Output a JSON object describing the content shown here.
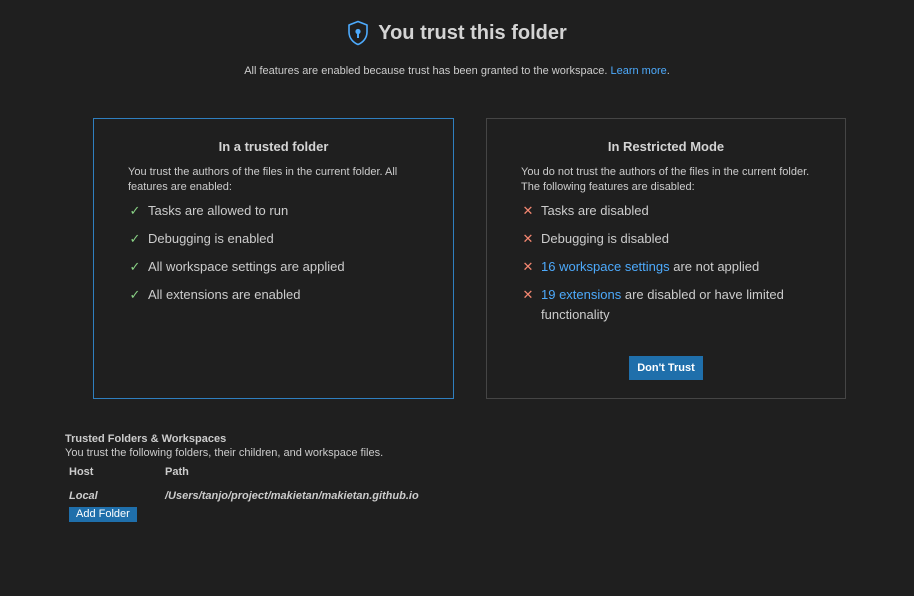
{
  "header": {
    "icon": "shield-icon",
    "title": "You trust this folder",
    "subtitle": "All features are enabled because trust has been granted to the workspace.",
    "learn_more": "Learn more",
    "period": "."
  },
  "trusted_card": {
    "title": "In a trusted folder",
    "description": "You trust the authors of the files in the current folder. All features are enabled:",
    "features": [
      {
        "icon": "check-icon",
        "text": "Tasks are allowed to run"
      },
      {
        "icon": "check-icon",
        "text": "Debugging is enabled"
      },
      {
        "icon": "check-icon",
        "text": "All workspace settings are applied"
      },
      {
        "icon": "check-icon",
        "text": "All extensions are enabled"
      }
    ]
  },
  "restricted_card": {
    "title": "In Restricted Mode",
    "description": "You do not trust the authors of the files in the current folder. The following features are disabled:",
    "features": [
      {
        "icon": "x-icon",
        "text": "Tasks are disabled"
      },
      {
        "icon": "x-icon",
        "text": "Debugging is disabled"
      },
      {
        "icon": "x-icon",
        "link": "16 workspace settings",
        "text": " are not applied"
      },
      {
        "icon": "x-icon",
        "link": "19 extensions",
        "text": " are disabled or have limited functionality"
      }
    ],
    "button": "Don't Trust"
  },
  "trusted_folders": {
    "title": "Trusted Folders & Workspaces",
    "description": "You trust the following folders, their children, and workspace files.",
    "columns": {
      "host": "Host",
      "path": "Path"
    },
    "rows": [
      {
        "host": "Local",
        "path": "/Users/tanjo/project/makietan/makietan.github.io"
      }
    ],
    "add_button": "Add Folder"
  },
  "colors": {
    "background": "#1f1f1f",
    "accent": "#2f7fbf",
    "link": "#4daafc",
    "check": "#89d185",
    "cross": "#f48771",
    "button": "#1f6fab"
  }
}
